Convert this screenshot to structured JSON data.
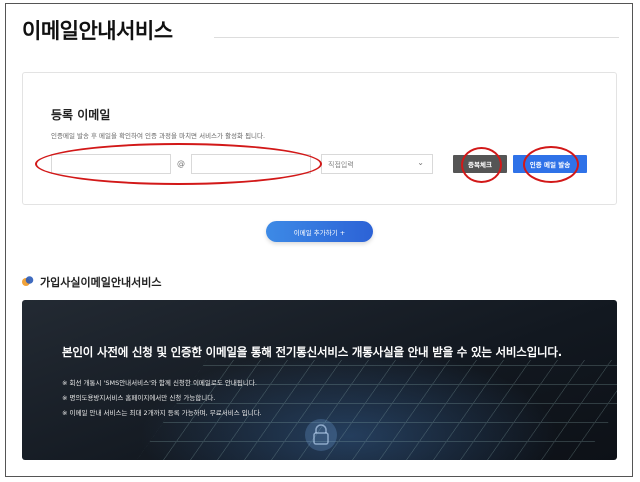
{
  "page": {
    "title": "이메일안내서비스"
  },
  "email_card": {
    "heading": "등록 이메일",
    "description": "인증메일 발송 후 메일을 확인하여 인증 과정을 마치면 서비스가 활성화 됩니다.",
    "local_part": {
      "value": "",
      "placeholder": ""
    },
    "at_symbol": "@",
    "domain_part": {
      "value": "",
      "placeholder": ""
    },
    "domain_select": {
      "selected": "직접입력"
    },
    "duplicate_check_label": "중복체크",
    "send_verification_label": "인증 메일 발송"
  },
  "add_email_label": "이메일 추가하기 +",
  "section": {
    "title": "가입사실이메일안내서비스"
  },
  "banner": {
    "headline": "본인이 사전에 신청 및 인증한 이메일을 통해 전기통신서비스 개통사실을 안내 받을 수 있는 서비스입니다.",
    "notes": [
      "※ 회선 개통시 'SMS안내서비스'와 함께 신청한 이메일로도 안내됩니다.",
      "※ 명의도용방지서비스 홈페이지에서만 신청 가능합니다.",
      "※ 이메일 안내 서비스는 최대 2개까지 등록 가능하며, 무료서비스 입니다."
    ]
  },
  "colors": {
    "accent_blue": "#2f72e8",
    "dark_button": "#555555",
    "annotation_red": "#d21818"
  }
}
